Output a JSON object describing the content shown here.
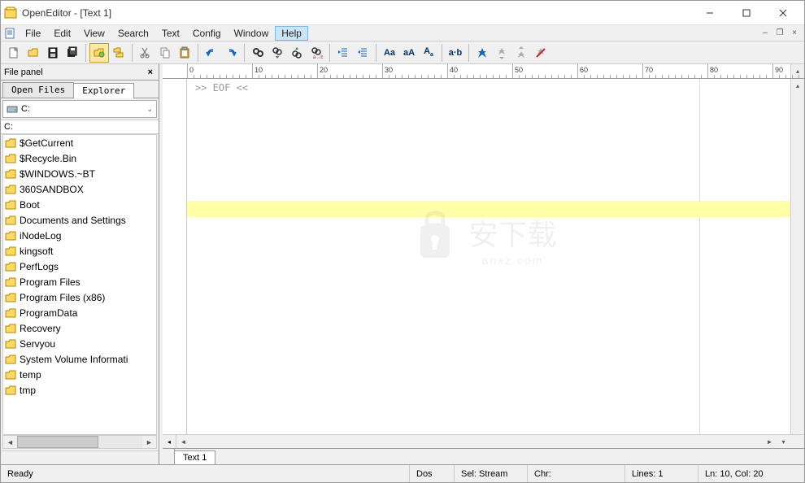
{
  "window": {
    "title": "OpenEditor - [Text 1]"
  },
  "menu": {
    "items": [
      "File",
      "Edit",
      "View",
      "Search",
      "Text",
      "Config",
      "Window",
      "Help"
    ],
    "highlighted": "Help"
  },
  "toolbar": {
    "groups": [
      [
        "new-file",
        "open-file",
        "save-file",
        "save-all"
      ],
      [
        "folder-open",
        "folder-tree"
      ],
      [
        "cut",
        "copy",
        "paste"
      ],
      [
        "undo",
        "redo"
      ],
      [
        "find",
        "find-next",
        "find-prev",
        "replace"
      ],
      [
        "indent",
        "outdent"
      ],
      [
        "Aa",
        "aA",
        "Aa-toggle"
      ],
      [
        "a-b"
      ],
      [
        "bookmark",
        "bookmark-prev",
        "bookmark-next",
        "bookmark-clear"
      ]
    ]
  },
  "filepanel": {
    "title": "File panel",
    "tabs": [
      "Open Files",
      "Explorer"
    ],
    "active_tab": "Explorer",
    "drive": "C:",
    "path": "C:",
    "folders": [
      "$GetCurrent",
      "$Recycle.Bin",
      "$WINDOWS.~BT",
      "360SANDBOX",
      "Boot",
      "Documents and Settings",
      "iNodeLog",
      "kingsoft",
      "PerfLogs",
      "Program Files",
      "Program Files (x86)",
      "ProgramData",
      "Recovery",
      "Servyou",
      "System Volume Informati",
      "temp",
      "tmp"
    ]
  },
  "editor": {
    "eof_marker": ">> EOF <<",
    "ruler_ticks": [
      0,
      10,
      20,
      30,
      40,
      50,
      60,
      70,
      80,
      90
    ],
    "document_tab": "Text 1"
  },
  "status": {
    "ready": "Ready",
    "mode": "Dos",
    "sel": "Sel: Stream",
    "chr": "Chr:",
    "lines": "Lines: 1",
    "pos": "Ln: 10, Col: 20"
  },
  "watermark": {
    "text": "安下载",
    "sub": "anxz.com"
  }
}
